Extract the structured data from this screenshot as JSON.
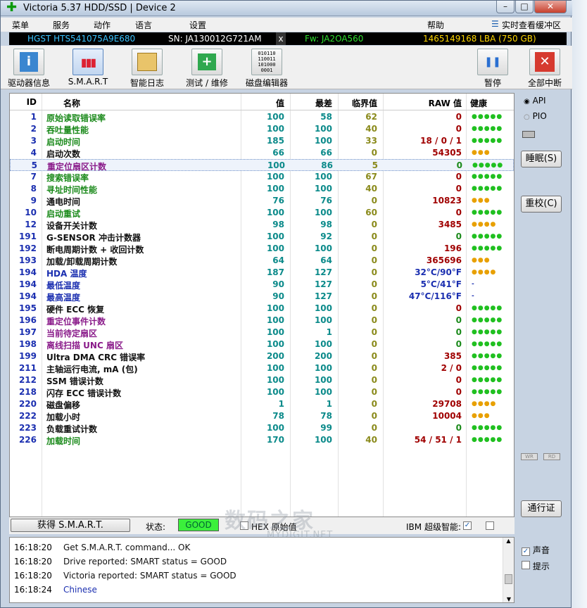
{
  "window": {
    "title": "Victoria 5.37 HDD/SSD | Device 2",
    "app_icon": "green-cross-icon",
    "buttons": {
      "minimize": "–",
      "maximize": "□",
      "close": "✕"
    }
  },
  "menu": [
    "菜单",
    "服务",
    "动作",
    "语言",
    "设置",
    "帮助"
  ],
  "menu_right": "实时查看缓冲区",
  "device": {
    "model": "HGST HTS541075A9E680",
    "serial": "SN: JA130012G721AM",
    "close_mark": "x",
    "firmware": "Fw: JA2OA560",
    "capacity": "1465149168 LBA (750 GB)"
  },
  "toolbar": {
    "drive_info": "驱动器信息",
    "smart": "S.M.A.R.T",
    "smart_log": "智能日志",
    "test": "测试 / 维修",
    "disk_editor": "磁盘编辑器",
    "pause": "暂停",
    "abort": "全部中断"
  },
  "table_headers": {
    "id": "ID",
    "name": "名称",
    "value": "值",
    "worst": "最差",
    "threshold": "临界值",
    "raw": "RAW 值",
    "health": "健康"
  },
  "colors": {
    "green": "#1b8a1b",
    "black": "#111111",
    "purple": "#8a1b8a",
    "blue": "#1b2fb0",
    "teal": "#0b8a8a",
    "raw_red": "#a00000",
    "raw_green": "#1b8a1b",
    "raw_blue": "#1b2fb0",
    "good": "#20c020",
    "warn": "#e8a000"
  },
  "rows": [
    {
      "id": "1",
      "name": "原始读取错误率",
      "value": "100",
      "worst": "58",
      "thr": "62",
      "raw": "0",
      "health": "●●●●●",
      "name_color": "green",
      "raw_color": "raw_red",
      "health_color": "good"
    },
    {
      "id": "2",
      "name": "吞吐量性能",
      "value": "100",
      "worst": "100",
      "thr": "40",
      "raw": "0",
      "health": "●●●●●",
      "name_color": "green",
      "raw_color": "raw_red",
      "health_color": "good"
    },
    {
      "id": "3",
      "name": "启动时间",
      "value": "185",
      "worst": "100",
      "thr": "33",
      "raw": "18 / 0 / 1",
      "health": "●●●●●",
      "name_color": "green",
      "raw_color": "raw_red",
      "health_color": "good"
    },
    {
      "id": "4",
      "name": "启动次数",
      "value": "66",
      "worst": "66",
      "thr": "0",
      "raw": "54305",
      "health": "●●●",
      "name_color": "black",
      "raw_color": "raw_red",
      "health_color": "warn"
    },
    {
      "id": "5",
      "name": "重定位扇区计数",
      "value": "100",
      "worst": "86",
      "thr": "5",
      "raw": "0",
      "health": "●●●●●",
      "name_color": "purple",
      "raw_color": "raw_green",
      "health_color": "good",
      "selected": true
    },
    {
      "id": "7",
      "name": "搜索错误率",
      "value": "100",
      "worst": "100",
      "thr": "67",
      "raw": "0",
      "health": "●●●●●",
      "name_color": "green",
      "raw_color": "raw_red",
      "health_color": "good"
    },
    {
      "id": "8",
      "name": "寻址时间性能",
      "value": "100",
      "worst": "100",
      "thr": "40",
      "raw": "0",
      "health": "●●●●●",
      "name_color": "green",
      "raw_color": "raw_red",
      "health_color": "good"
    },
    {
      "id": "9",
      "name": "通电时间",
      "value": "76",
      "worst": "76",
      "thr": "0",
      "raw": "10823",
      "health": "●●●",
      "name_color": "black",
      "raw_color": "raw_red",
      "health_color": "warn"
    },
    {
      "id": "10",
      "name": "启动重试",
      "value": "100",
      "worst": "100",
      "thr": "60",
      "raw": "0",
      "health": "●●●●●",
      "name_color": "green",
      "raw_color": "raw_red",
      "health_color": "good"
    },
    {
      "id": "12",
      "name": "设备开关计数",
      "value": "98",
      "worst": "98",
      "thr": "0",
      "raw": "3485",
      "health": "●●●●",
      "name_color": "black",
      "raw_color": "raw_red",
      "health_color": "warn"
    },
    {
      "id": "191",
      "name": "G-SENSOR 冲击计数器",
      "value": "100",
      "worst": "92",
      "thr": "0",
      "raw": "0",
      "health": "●●●●●",
      "name_color": "black",
      "raw_color": "raw_green",
      "health_color": "good"
    },
    {
      "id": "192",
      "name": "断电周期计数 + 收回计数",
      "value": "100",
      "worst": "100",
      "thr": "0",
      "raw": "196",
      "health": "●●●●●",
      "name_color": "black",
      "raw_color": "raw_red",
      "health_color": "good"
    },
    {
      "id": "193",
      "name": "加载/卸载周期计数",
      "value": "64",
      "worst": "64",
      "thr": "0",
      "raw": "365696",
      "health": "●●●",
      "name_color": "black",
      "raw_color": "raw_red",
      "health_color": "warn"
    },
    {
      "id": "194",
      "name": "HDA 温度",
      "value": "187",
      "worst": "127",
      "thr": "0",
      "raw": "32°C/90°F",
      "health": "●●●●",
      "name_color": "blue",
      "raw_color": "raw_blue",
      "health_color": "warn"
    },
    {
      "id": "194",
      "name": "最低温度",
      "value": "90",
      "worst": "127",
      "thr": "0",
      "raw": "5°C/41°F",
      "health": "-",
      "name_color": "blue",
      "raw_color": "raw_blue",
      "health_color": "blue"
    },
    {
      "id": "194",
      "name": "最高温度",
      "value": "90",
      "worst": "127",
      "thr": "0",
      "raw": "47°C/116°F",
      "health": "-",
      "name_color": "blue",
      "raw_color": "raw_blue",
      "health_color": "blue"
    },
    {
      "id": "195",
      "name": "硬件 ECC 恢复",
      "value": "100",
      "worst": "100",
      "thr": "0",
      "raw": "0",
      "health": "●●●●●",
      "name_color": "black",
      "raw_color": "raw_red",
      "health_color": "good"
    },
    {
      "id": "196",
      "name": "重定位事件计数",
      "value": "100",
      "worst": "100",
      "thr": "0",
      "raw": "0",
      "health": "●●●●●",
      "name_color": "purple",
      "raw_color": "raw_green",
      "health_color": "good"
    },
    {
      "id": "197",
      "name": "当前待定扇区",
      "value": "100",
      "worst": "1",
      "thr": "0",
      "raw": "0",
      "health": "●●●●●",
      "name_color": "purple",
      "raw_color": "raw_green",
      "health_color": "good"
    },
    {
      "id": "198",
      "name": "离线扫描 UNC 扇区",
      "value": "100",
      "worst": "100",
      "thr": "0",
      "raw": "0",
      "health": "●●●●●",
      "name_color": "purple",
      "raw_color": "raw_green",
      "health_color": "good"
    },
    {
      "id": "199",
      "name": "Ultra DMA CRC 错误率",
      "value": "200",
      "worst": "200",
      "thr": "0",
      "raw": "385",
      "health": "●●●●●",
      "name_color": "black",
      "raw_color": "raw_red",
      "health_color": "good"
    },
    {
      "id": "211",
      "name": "主轴运行电流, mA (包)",
      "value": "100",
      "worst": "100",
      "thr": "0",
      "raw": "2 / 0",
      "health": "●●●●●",
      "name_color": "black",
      "raw_color": "raw_red",
      "health_color": "good"
    },
    {
      "id": "212",
      "name": "SSM 错误计数",
      "value": "100",
      "worst": "100",
      "thr": "0",
      "raw": "0",
      "health": "●●●●●",
      "name_color": "black",
      "raw_color": "raw_red",
      "health_color": "good"
    },
    {
      "id": "218",
      "name": "闪存 ECC 错误计数",
      "value": "100",
      "worst": "100",
      "thr": "0",
      "raw": "0",
      "health": "●●●●●",
      "name_color": "black",
      "raw_color": "raw_red",
      "health_color": "good"
    },
    {
      "id": "220",
      "name": "磁盘偏移",
      "value": "1",
      "worst": "1",
      "thr": "0",
      "raw": "29708",
      "health": "●●●●",
      "name_color": "black",
      "raw_color": "raw_red",
      "health_color": "warn"
    },
    {
      "id": "222",
      "name": "加载小时",
      "value": "78",
      "worst": "78",
      "thr": "0",
      "raw": "10004",
      "health": "●●●",
      "name_color": "black",
      "raw_color": "raw_red",
      "health_color": "warn"
    },
    {
      "id": "223",
      "name": "负载重试计数",
      "value": "100",
      "worst": "99",
      "thr": "0",
      "raw": "0",
      "health": "●●●●●",
      "name_color": "black",
      "raw_color": "raw_green",
      "health_color": "good"
    },
    {
      "id": "226",
      "name": "加载时间",
      "value": "170",
      "worst": "100",
      "thr": "40",
      "raw": "54 / 51 / 1",
      "health": "●●●●●",
      "name_color": "green",
      "raw_color": "raw_red",
      "health_color": "good"
    }
  ],
  "right_panel": {
    "api": "API",
    "pio": "PIO",
    "sleep": "睡眠(S)",
    "recal": "重校(C)",
    "wr": "WR",
    "rd": "RD",
    "passport": "通行证",
    "sound": "声音",
    "hints": "提示"
  },
  "bottom": {
    "get_smart": "获得 S.M.A.R.T.",
    "status_label": "状态:",
    "status_value": "GOOD",
    "hex_raw": "HEX 原始值",
    "ibm": "IBM 超级智能:"
  },
  "log": [
    {
      "time": "16:18:20",
      "msg": "Get S.M.A.R.T. command... OK",
      "color": "#111111"
    },
    {
      "time": "16:18:20",
      "msg": "Drive reported: SMART status = GOOD",
      "color": "#111111"
    },
    {
      "time": "16:18:20",
      "msg": "Victoria reported: SMART status = GOOD",
      "color": "#111111"
    },
    {
      "time": "16:18:24",
      "msg": "Chinese",
      "color": "#1b2fb0"
    }
  ],
  "watermark": {
    "main": "数码之家",
    "sub": "MYDIGIT.NET"
  }
}
